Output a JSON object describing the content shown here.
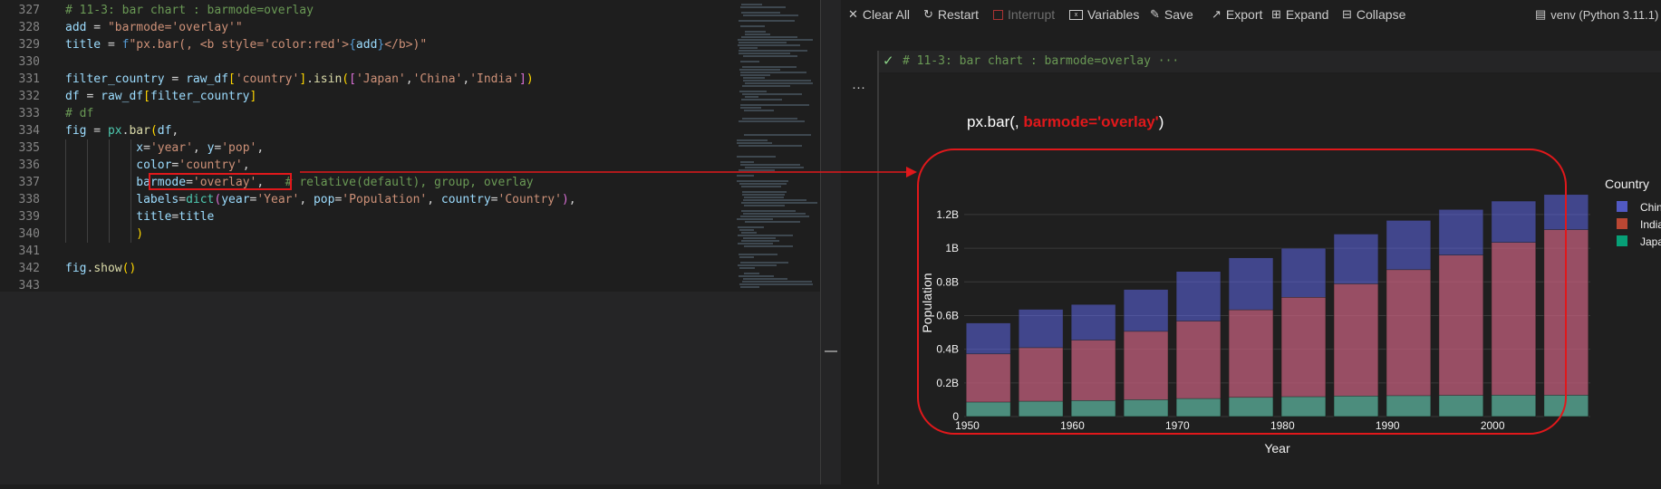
{
  "editor": {
    "lines": [
      {
        "n": "327",
        "segs": [
          [
            "# 11-3: bar chart : barmode=overlay",
            "#6a9955"
          ]
        ]
      },
      {
        "n": "328",
        "segs": [
          [
            "add",
            "#9cdcfe"
          ],
          [
            " = ",
            "#d4d4d4"
          ],
          [
            "\"barmode='overlay'\"",
            "#ce9178"
          ]
        ]
      },
      {
        "n": "329",
        "segs": [
          [
            "title",
            "#9cdcfe"
          ],
          [
            " = ",
            "#d4d4d4"
          ],
          [
            "f",
            "#569cd6"
          ],
          [
            "\"px.bar(, <b style='color:red'>",
            "#ce9178"
          ],
          [
            "{",
            "#569cd6"
          ],
          [
            "add",
            "#9cdcfe"
          ],
          [
            "}",
            "#569cd6"
          ],
          [
            "</b>)\"",
            "#ce9178"
          ]
        ]
      },
      {
        "n": "330",
        "segs": []
      },
      {
        "n": "331",
        "segs": [
          [
            "filter_country",
            "#9cdcfe"
          ],
          [
            " = ",
            "#d4d4d4"
          ],
          [
            "raw_df",
            "#9cdcfe"
          ],
          [
            "[",
            "#ffd700"
          ],
          [
            "'country'",
            "#ce9178"
          ],
          [
            "]",
            "#ffd700"
          ],
          [
            ".",
            "#d4d4d4"
          ],
          [
            "isin",
            "#dcdcaa"
          ],
          [
            "(",
            "#ffd700"
          ],
          [
            "[",
            "#da70d6"
          ],
          [
            "'Japan'",
            "#ce9178"
          ],
          [
            ",",
            "#d4d4d4"
          ],
          [
            "'China'",
            "#ce9178"
          ],
          [
            ",",
            "#d4d4d4"
          ],
          [
            "'India'",
            "#ce9178"
          ],
          [
            "]",
            "#da70d6"
          ],
          [
            ")",
            "#ffd700"
          ]
        ]
      },
      {
        "n": "332",
        "segs": [
          [
            "df",
            "#9cdcfe"
          ],
          [
            " = ",
            "#d4d4d4"
          ],
          [
            "raw_df",
            "#9cdcfe"
          ],
          [
            "[",
            "#ffd700"
          ],
          [
            "filter_country",
            "#9cdcfe"
          ],
          [
            "]",
            "#ffd700"
          ]
        ]
      },
      {
        "n": "333",
        "segs": [
          [
            "# df",
            "#6a9955"
          ]
        ]
      },
      {
        "n": "334",
        "segs": [
          [
            "fig",
            "#9cdcfe"
          ],
          [
            " = ",
            "#d4d4d4"
          ],
          [
            "px",
            "#4ec9b0"
          ],
          [
            ".",
            "#d4d4d4"
          ],
          [
            "bar",
            "#dcdcaa"
          ],
          [
            "(",
            "#ffd700"
          ],
          [
            "df",
            "#9cdcfe"
          ],
          [
            ",",
            "#d4d4d4"
          ]
        ]
      },
      {
        "n": "335",
        "segs": [
          [
            "          ",
            "#d4d4d4"
          ],
          [
            "x",
            "#9cdcfe"
          ],
          [
            "=",
            "#d4d4d4"
          ],
          [
            "'year'",
            "#ce9178"
          ],
          [
            ", ",
            "#d4d4d4"
          ],
          [
            "y",
            "#9cdcfe"
          ],
          [
            "=",
            "#d4d4d4"
          ],
          [
            "'pop'",
            "#ce9178"
          ],
          [
            ",",
            "#d4d4d4"
          ]
        ]
      },
      {
        "n": "336",
        "segs": [
          [
            "          ",
            "#d4d4d4"
          ],
          [
            "color",
            "#9cdcfe"
          ],
          [
            "=",
            "#d4d4d4"
          ],
          [
            "'country'",
            "#ce9178"
          ],
          [
            ",",
            "#d4d4d4"
          ]
        ]
      },
      {
        "n": "337",
        "segs": [
          [
            "          ",
            "#d4d4d4"
          ],
          [
            "barmode",
            "#9cdcfe"
          ],
          [
            "=",
            "#d4d4d4"
          ],
          [
            "'overlay'",
            "#ce9178"
          ],
          [
            ",",
            "#d4d4d4"
          ],
          [
            "   ",
            "#d4d4d4"
          ],
          [
            "# relative(default), group, overlay",
            "#6a9955"
          ]
        ]
      },
      {
        "n": "338",
        "segs": [
          [
            "          ",
            "#d4d4d4"
          ],
          [
            "labels",
            "#9cdcfe"
          ],
          [
            "=",
            "#d4d4d4"
          ],
          [
            "dict",
            "#4ec9b0"
          ],
          [
            "(",
            "#da70d6"
          ],
          [
            "year",
            "#9cdcfe"
          ],
          [
            "=",
            "#d4d4d4"
          ],
          [
            "'Year'",
            "#ce9178"
          ],
          [
            ", ",
            "#d4d4d4"
          ],
          [
            "pop",
            "#9cdcfe"
          ],
          [
            "=",
            "#d4d4d4"
          ],
          [
            "'Population'",
            "#ce9178"
          ],
          [
            ", ",
            "#d4d4d4"
          ],
          [
            "country",
            "#9cdcfe"
          ],
          [
            "=",
            "#d4d4d4"
          ],
          [
            "'Country'",
            "#ce9178"
          ],
          [
            ")",
            "#da70d6"
          ],
          [
            ",",
            "#d4d4d4"
          ]
        ]
      },
      {
        "n": "339",
        "segs": [
          [
            "          ",
            "#d4d4d4"
          ],
          [
            "title",
            "#9cdcfe"
          ],
          [
            "=",
            "#d4d4d4"
          ],
          [
            "title",
            "#9cdcfe"
          ]
        ]
      },
      {
        "n": "340",
        "segs": [
          [
            "          ",
            "#d4d4d4"
          ],
          [
            ")",
            "#ffd700"
          ]
        ]
      },
      {
        "n": "341",
        "segs": []
      },
      {
        "n": "342",
        "segs": [
          [
            "fig",
            "#9cdcfe"
          ],
          [
            ".",
            "#d4d4d4"
          ],
          [
            "show",
            "#dcdcaa"
          ],
          [
            "()",
            "#ffd700"
          ]
        ]
      },
      {
        "n": "343",
        "segs": []
      }
    ]
  },
  "toolbar": {
    "clear_all": "Clear All",
    "restart": "Restart",
    "interrupt": "Interrupt",
    "variables": "Variables",
    "save": "Save",
    "export": "Export",
    "expand": "Expand",
    "collapse": "Collapse",
    "kernel": "venv (Python 3.11.1)"
  },
  "cell": {
    "check": "✓",
    "header": "# 11-3: bar chart : barmode=overlay ···",
    "more": "···"
  },
  "plot": {
    "title_prefix": "px.bar(, ",
    "title_bold": "barmode='overlay'",
    "title_suffix": ")"
  },
  "colors": {
    "annotation": "#e0181b",
    "china": "#636efa",
    "india": "#ef553b",
    "japan": "#00cc96"
  },
  "chart_data": {
    "type": "bar",
    "barmode": "overlay",
    "title": "px.bar(, barmode='overlay')",
    "xlabel": "Year",
    "ylabel": "Population",
    "legend_title": "Country",
    "legend_position": "top-right",
    "x": [
      1952,
      1957,
      1962,
      1967,
      1972,
      1977,
      1982,
      1987,
      1992,
      1997,
      2002,
      2007
    ],
    "xticks": [
      "1950",
      "1960",
      "1970",
      "1980",
      "1990",
      "2000"
    ],
    "yticks": [
      "0",
      "0.2B",
      "0.4B",
      "0.6B",
      "0.8B",
      "1B",
      "1.2B"
    ],
    "ylim": [
      0,
      1.35
    ],
    "series": [
      {
        "name": "China",
        "values": [
          0.556,
          0.637,
          0.666,
          0.755,
          0.862,
          0.943,
          1.0,
          1.084,
          1.165,
          1.23,
          1.28,
          1.319
        ]
      },
      {
        "name": "India",
        "values": [
          0.372,
          0.409,
          0.454,
          0.506,
          0.567,
          0.634,
          0.708,
          0.788,
          0.872,
          0.959,
          1.034,
          1.11
        ]
      },
      {
        "name": "Japan",
        "values": [
          0.086,
          0.091,
          0.095,
          0.1,
          0.107,
          0.114,
          0.118,
          0.122,
          0.124,
          0.126,
          0.127,
          0.127
        ]
      }
    ]
  }
}
